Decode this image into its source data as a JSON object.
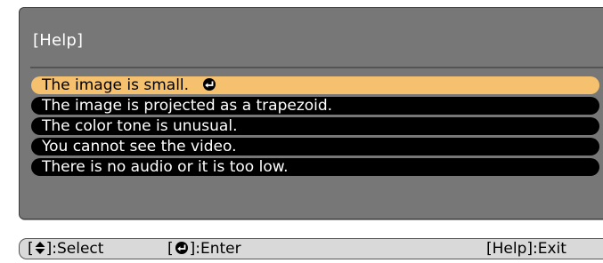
{
  "help_menu": {
    "title": "[Help]",
    "items": [
      {
        "label": "The image is small.",
        "selected": true
      },
      {
        "label": "The image is projected as a trapezoid.",
        "selected": false
      },
      {
        "label": "The color tone is unusual.",
        "selected": false
      },
      {
        "label": "You cannot see the video.",
        "selected": false
      },
      {
        "label": "There is no audio or it is too low.",
        "selected": false
      }
    ],
    "enter_icon": "enter-arrow-icon"
  },
  "footer": {
    "select_open": "[",
    "select_close": "]:Select",
    "select_icon": "up-down-arrow-icon",
    "enter_open": "[",
    "enter_close": "]:Enter",
    "enter_icon": "enter-arrow-icon",
    "exit_label": "[Help]:Exit"
  },
  "colors": {
    "panel_background": "#777777",
    "item_background": "#000000",
    "selected_item_background": "#f6c16e",
    "footer_background": "#d9d9d9"
  }
}
